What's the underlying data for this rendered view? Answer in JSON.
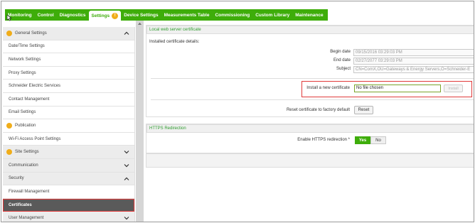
{
  "nav": {
    "items": [
      "Monitoring",
      "Control",
      "Diagnostics",
      "Settings",
      "Device Settings",
      "Measurements Table",
      "Commissioning",
      "Custom Library",
      "Maintenance"
    ],
    "active": "Settings",
    "warning_glyph": "!"
  },
  "sidebar": {
    "items": [
      {
        "label": "General Settings",
        "type": "group",
        "warning": true,
        "chevron": "up"
      },
      {
        "label": "Date/Time Settings",
        "type": "item"
      },
      {
        "label": "Network Settings",
        "type": "item"
      },
      {
        "label": "Proxy Settings",
        "type": "item"
      },
      {
        "label": "Schneider Electric Services",
        "type": "item"
      },
      {
        "label": "Contact Management",
        "type": "item"
      },
      {
        "label": "Email Settings",
        "type": "item"
      },
      {
        "label": "Publication",
        "type": "item",
        "warning": true
      },
      {
        "label": "Wi-Fi Access Point Settings",
        "type": "item"
      },
      {
        "label": "Site Settings",
        "type": "group",
        "warning": true,
        "chevron": "down"
      },
      {
        "label": "Communication",
        "type": "group",
        "chevron": "down"
      },
      {
        "label": "Security",
        "type": "group",
        "chevron": "up"
      },
      {
        "label": "Firewall Management",
        "type": "item"
      },
      {
        "label": "Certificates",
        "type": "item",
        "selected": true
      },
      {
        "label": "User Management",
        "type": "group",
        "chevron": "down"
      }
    ]
  },
  "certificate": {
    "header": "Local web server certificate",
    "installed_label": "Installed certificate details:",
    "begin_label": "Begin date",
    "begin_value": "09/15/2016 03:29:03 PM",
    "end_label": "End date",
    "end_value": "02/27/2077 03:29:03 PM",
    "subject_label": "Subject",
    "subject_value": "CN=ComX,OU=Gateways & Energy Servers,O=Schneider-E",
    "install_label": "Install a new certificate",
    "file_placeholder": "No file chosen",
    "install_button": "Install",
    "reset_label": "Reset certificate to factory default",
    "reset_button": "Reset"
  },
  "https": {
    "header": "HTTPS Redirection",
    "enable_label": "Enable HTTPS redirection *",
    "yes": "Yes",
    "no": "No"
  },
  "colors": {
    "accent": "#3ead0a",
    "warning": "#f0ad1a",
    "highlight_outline": "#e03a3a"
  }
}
